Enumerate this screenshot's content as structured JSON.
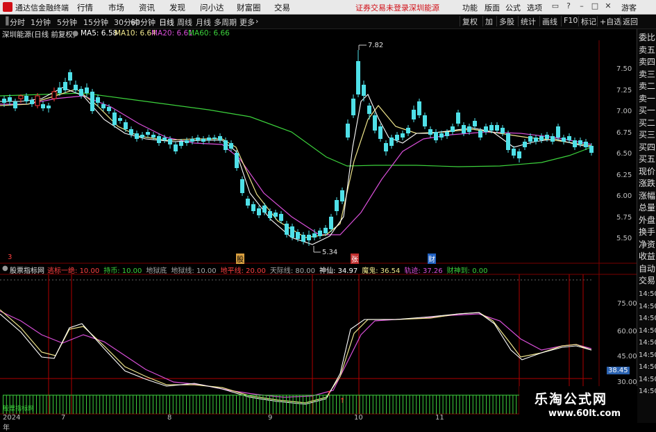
{
  "window": {
    "title": "通达信金融终端",
    "menu": [
      "行情",
      "市场",
      "资讯",
      "发现",
      "问小达",
      "财富圈",
      "交易"
    ],
    "notices": [
      "证券交易未登录",
      "深圳能源"
    ],
    "right_menu": [
      "功能",
      "版面",
      "公式",
      "选项",
      "游客"
    ]
  },
  "toolbar": {
    "periods": [
      "分时",
      "1分钟",
      "5分钟",
      "15分钟",
      "30分钟",
      "60分钟",
      "日线",
      "周线",
      "月线",
      "多周期",
      "更多"
    ],
    "active_period": "日线",
    "right_tools": [
      "复权",
      "加",
      "多股",
      "统计",
      "画线",
      "F10",
      "标记",
      "+自选",
      "返回"
    ]
  },
  "info": {
    "stock": "深圳能源(日线 前复权)",
    "ma": [
      {
        "label": "MA5: 6.58",
        "color": "#ffffff"
      },
      {
        "label": "MA10: 6.64",
        "color": "#f0e68c"
      },
      {
        "label": "MA20: 6.61",
        "color": "#d94fd9"
      },
      {
        "label": "MA60: 6.66",
        "color": "#3cd23c"
      }
    ]
  },
  "price_axis": [
    "7.50",
    "7.25",
    "7.00",
    "6.75",
    "6.50",
    "6.25",
    "6.00",
    "5.75",
    "5.50"
  ],
  "annotations": {
    "high": "7.82",
    "low": "5.34"
  },
  "event_markers": [
    "3",
    "股",
    "张",
    "财"
  ],
  "indicator": {
    "name": "股票指标网",
    "items": [
      {
        "label": "逃标一绝",
        "value": "10.00",
        "color": "#ff4040"
      },
      {
        "label": "持币",
        "value": "10.00",
        "color": "#3cd23c"
      },
      {
        "label": "地狱底",
        "value": "",
        "color": "#aaaaaa"
      },
      {
        "label": "地狱线",
        "value": "10.00",
        "color": "#aaaaaa"
      },
      {
        "label": "地平线",
        "value": "20.00",
        "color": "#ff4040"
      },
      {
        "label": "天际线",
        "value": "80.00",
        "color": "#aaaaaa"
      },
      {
        "label": "神仙",
        "value": "34.97",
        "color": "#ffffff"
      },
      {
        "label": "魔鬼",
        "value": "36.54",
        "color": "#f0e68c"
      },
      {
        "label": "轨迹",
        "value": "37.26",
        "color": "#d94fd9"
      },
      {
        "label": "财神到",
        "value": "0.00",
        "color": "#3cd23c"
      }
    ],
    "axis": [
      "75.00",
      "60.00",
      "45.00",
      "30.00"
    ],
    "current_value": "38.45",
    "bottom_label": "股票指标网"
  },
  "right_panel": [
    "委比",
    "卖五",
    "卖四",
    "卖三",
    "卖二",
    "卖一",
    "买一",
    "买二",
    "买三",
    "买四",
    "买五",
    "现价",
    "涨跌",
    "涨幅",
    "总量",
    "外盘",
    "换手",
    "净资",
    "收益",
    "自动",
    "交易"
  ],
  "right_panel_times": [
    "14:50",
    "14:50",
    "14:50",
    "14:50",
    "14:50",
    "14:50",
    "14:50",
    "14:50",
    "14:50"
  ],
  "dates": [
    "2024年",
    "7",
    "8",
    "9",
    "10",
    "11"
  ],
  "watermark": {
    "title": "乐淘公式网",
    "url": "www.60lt.com"
  }
}
